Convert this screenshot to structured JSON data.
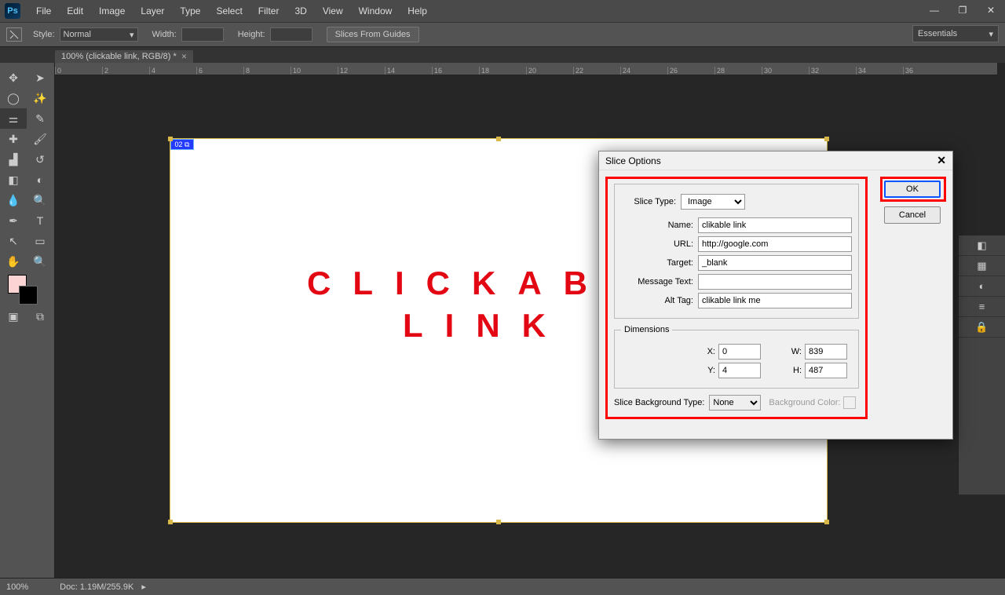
{
  "app": {
    "logo": "Ps"
  },
  "menu": [
    "File",
    "Edit",
    "Image",
    "Layer",
    "Type",
    "Select",
    "Filter",
    "3D",
    "View",
    "Window",
    "Help"
  ],
  "optbar": {
    "style_label": "Style:",
    "style_value": "Normal",
    "width_label": "Width:",
    "height_label": "Height:",
    "slices_btn": "Slices From Guides"
  },
  "workspace_switcher": "Essentials",
  "tab": {
    "label": "100% (clickable link, RGB/8) *"
  },
  "ruler_marks": [
    "0",
    "2",
    "4",
    "6",
    "8",
    "10",
    "12",
    "14",
    "16",
    "18",
    "20",
    "22",
    "24",
    "26",
    "28",
    "30",
    "32",
    "34",
    "36"
  ],
  "canvas": {
    "slice_badge": "02 ⧉",
    "line1": "CLICKABL",
    "line2": "LINK"
  },
  "status": {
    "zoom": "100%",
    "doc": "Doc: 1.19M/255.9K"
  },
  "dialog": {
    "title": "Slice Options",
    "slice_type_label": "Slice Type:",
    "slice_type_value": "Image",
    "name_label": "Name:",
    "name_value": "clikable link",
    "url_label": "URL:",
    "url_value": "http://google.com",
    "target_label": "Target:",
    "target_value": "_blank",
    "msg_label": "Message Text:",
    "msg_value": "",
    "alt_label": "Alt Tag:",
    "alt_value": "clikable link me",
    "dim_legend": "Dimensions",
    "x_label": "X:",
    "x_value": "0",
    "y_label": "Y:",
    "y_value": "4",
    "w_label": "W:",
    "w_value": "839",
    "h_label": "H:",
    "h_value": "487",
    "bgtype_label": "Slice Background Type:",
    "bgtype_value": "None",
    "bgcolor_label": "Background Color:",
    "ok": "OK",
    "cancel": "Cancel"
  }
}
